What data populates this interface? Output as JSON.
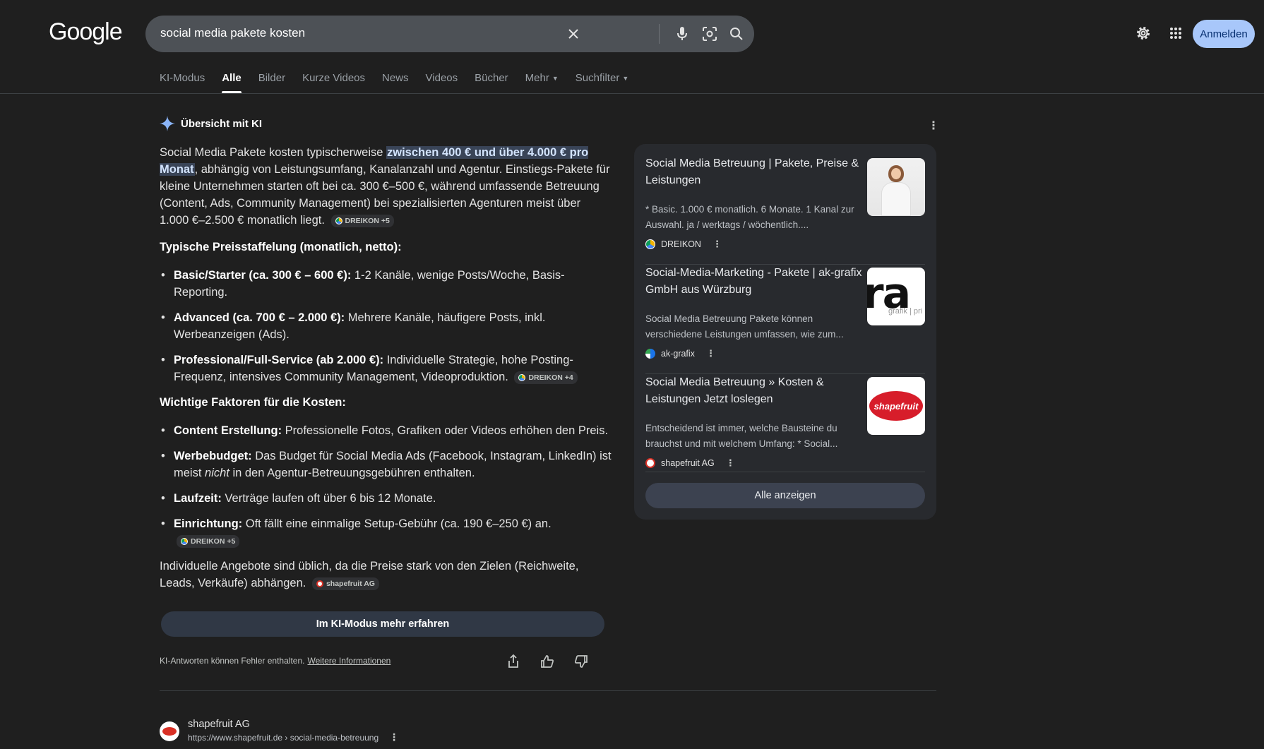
{
  "header": {
    "logo": "Google",
    "search_query": "social media pakete kosten",
    "signin_label": "Anmelden"
  },
  "tabs": [
    {
      "label": "KI-Modus",
      "active": false
    },
    {
      "label": "Alle",
      "active": true
    },
    {
      "label": "Bilder",
      "active": false
    },
    {
      "label": "Kurze Videos",
      "active": false
    },
    {
      "label": "News",
      "active": false
    },
    {
      "label": "Videos",
      "active": false
    },
    {
      "label": "Bücher",
      "active": false
    },
    {
      "label": "Mehr",
      "active": false
    },
    {
      "label": "Suchfilter",
      "active": false
    }
  ],
  "ai_overview": {
    "title": "Übersicht mit KI",
    "intro_before": "Social Media Pakete kosten typischerweise ",
    "intro_highlight": "zwischen 400 € und über 4.000 € pro Monat",
    "intro_after": ", abhängig von Leistungsumfang, Kanalanzahl und Agentur. Einstiegs-Pakete für kleine Unternehmen starten oft bei ca. 300 €–500 €, während umfassende Betreuung (Content, Ads, Community Management) bei spezialisierten Agenturen meist über 1.000 €–2.500 € monatlich liegt.",
    "intro_chip": "DREIKON +5",
    "heading1": "Typische Preisstaffelung (monatlich, netto):",
    "tiers": [
      {
        "bold": "Basic/Starter (ca. 300 € – 600 €):",
        "text": " 1-2 Kanäle, wenige Posts/Woche, Basis-Reporting.",
        "chip": ""
      },
      {
        "bold": "Advanced (ca. 700 € – 2.000 €):",
        "text": " Mehrere Kanäle, häufigere Posts, inkl. Werbeanzeigen (Ads).",
        "chip": ""
      },
      {
        "bold": "Professional/Full-Service (ab 2.000 €):",
        "text": " Individuelle Strategie, hohe Posting-Frequenz, intensives Community Management, Videoproduktion.",
        "chip": "DREIKON +4"
      }
    ],
    "heading2": "Wichtige Faktoren für die Kosten:",
    "factors": {
      "f1_bold": "Content Erstellung:",
      "f1_text": " Professionelle Fotos, Grafiken oder Videos erhöhen den Preis.",
      "f2_bold": "Werbebudget:",
      "f2_text_a": " Das Budget für Social Media Ads (Facebook, Instagram, LinkedIn) ist meist ",
      "f2_em": "nicht",
      "f2_text_b": " in den Agentur-Betreuungsgebühren enthalten.",
      "f3_bold": "Laufzeit:",
      "f3_text": " Verträge laufen oft über 6 bis 12 Monate.",
      "f4_bold": "Einrichtung:",
      "f4_text": " Oft fällt eine einmalige Setup-Gebühr (ca. 190 €–250 €) an.",
      "f4_chip": "DREIKON +5"
    },
    "closing": "Individuelle Angebote sind üblich, da die Preise stark von den Zielen (Reichweite, Leads, Verkäufe) abhängen.",
    "closing_chip": "shapefruit AG",
    "ki_button": "Im KI-Modus mehr erfahren",
    "disclaimer": "KI-Antworten können Fehler enthalten.",
    "disclaimer_link": "Weitere Informationen"
  },
  "sources": [
    {
      "title": "Social Media Betreuung | Pakete, Preise & Leistungen",
      "desc": "* Basic. 1.000 € monatlich. 6 Monate. 1 Kanal zur Auswahl. ja / werktags / wöchentlich....",
      "site": "DREIKON"
    },
    {
      "title": "Social-Media-Marketing - Pakete | ak-grafix GmbH aus Würzburg",
      "desc": "Social Media Betreuung Pakete können verschiedene Leistungen umfassen, wie zum...",
      "site": "ak-grafix",
      "thumb_big": "ra",
      "thumb_small": "grafik | pri"
    },
    {
      "title": "Social Media Betreuung » Kosten & Leistungen Jetzt loslegen",
      "desc": "Entscheidend ist immer, welche Bausteine du brauchst und mit welchem Umfang: * Social...",
      "site": "shapefruit AG",
      "thumb_text": "shapefruit"
    }
  ],
  "sources_button": "Alle anzeigen",
  "result": {
    "name": "shapefruit AG",
    "url": "https://www.shapefruit.de › social-media-betreuung"
  },
  "colors": {
    "background": "#1f1f1f",
    "signin_bg": "#a8c7fa",
    "highlight_bg": "#394457"
  }
}
